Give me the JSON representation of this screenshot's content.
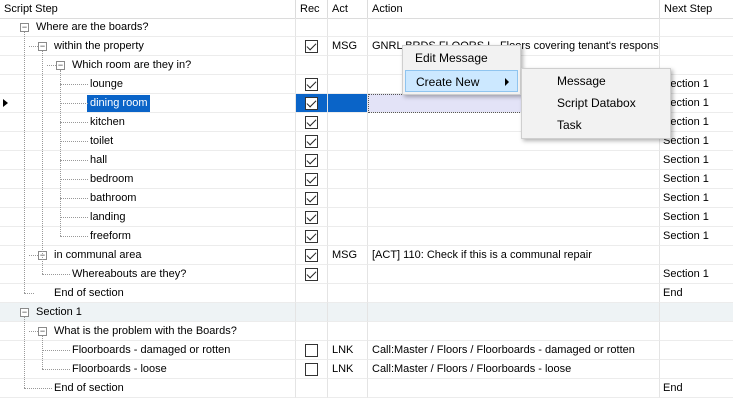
{
  "columns": {
    "step": "Script Step",
    "rec": "Rec",
    "act": "Act",
    "action": "Action",
    "next": "Next Step"
  },
  "rows": [
    {
      "step": "Where are the boards?",
      "rec": null,
      "act": "",
      "action": "",
      "next": ""
    },
    {
      "step": "within the property",
      "rec": true,
      "act": "MSG",
      "action": "GNRL BRDS FLOORS I - Floors covering tenant's responsibiliy",
      "next": ""
    },
    {
      "step": "Which room are they in?",
      "rec": null,
      "act": "",
      "action": "",
      "next": ""
    },
    {
      "step": "lounge",
      "rec": true,
      "act": "",
      "action": "",
      "next": "Section 1"
    },
    {
      "step": "dining room",
      "rec": true,
      "act": "",
      "action": "",
      "next": "Section 1"
    },
    {
      "step": "kitchen",
      "rec": true,
      "act": "",
      "action": "",
      "next": "Section 1"
    },
    {
      "step": "toilet",
      "rec": true,
      "act": "",
      "action": "",
      "next": "Section 1"
    },
    {
      "step": "hall",
      "rec": true,
      "act": "",
      "action": "",
      "next": "Section 1"
    },
    {
      "step": "bedroom",
      "rec": true,
      "act": "",
      "action": "",
      "next": "Section 1"
    },
    {
      "step": "bathroom",
      "rec": true,
      "act": "",
      "action": "",
      "next": "Section 1"
    },
    {
      "step": "landing",
      "rec": true,
      "act": "",
      "action": "",
      "next": "Section 1"
    },
    {
      "step": "freeform",
      "rec": true,
      "act": "",
      "action": "",
      "next": "Section 1"
    },
    {
      "step": "in communal area",
      "rec": true,
      "act": "MSG",
      "action": "[ACT] 110: Check if this is a communal repair",
      "next": ""
    },
    {
      "step": "Whereabouts are they?",
      "rec": true,
      "act": "",
      "action": "",
      "next": "Section 1"
    },
    {
      "step": "End of section",
      "rec": null,
      "act": "",
      "action": "",
      "next": "End"
    },
    {
      "step": "Section 1",
      "rec": null,
      "act": "",
      "action": "",
      "next": ""
    },
    {
      "step": "What is the problem with the Boards?",
      "rec": null,
      "act": "",
      "action": "",
      "next": ""
    },
    {
      "step": "Floorboards - damaged or rotten",
      "rec": false,
      "act": "LNK",
      "action": "Call:Master / Floors / Floorboards - damaged or rotten",
      "next": ""
    },
    {
      "step": "Floorboards - loose",
      "rec": false,
      "act": "LNK",
      "action": "Call:Master / Floors / Floorboards - loose",
      "next": ""
    },
    {
      "step": "End of section",
      "rec": null,
      "act": "",
      "action": "",
      "next": "End"
    }
  ],
  "context_menu": {
    "items": [
      "Edit Message",
      "Create New"
    ]
  },
  "submenu": {
    "items": [
      "Message",
      "Script Databox",
      "Task"
    ]
  }
}
